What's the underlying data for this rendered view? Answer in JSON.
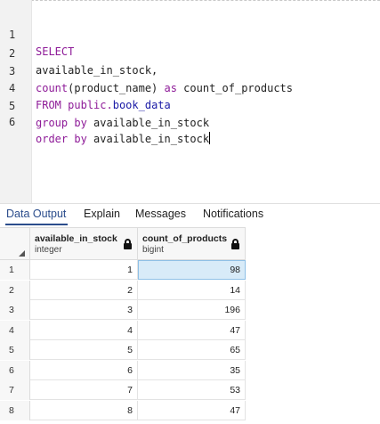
{
  "editor": {
    "lines": [
      {
        "n": "1"
      },
      {
        "n": "2"
      },
      {
        "n": "3"
      },
      {
        "n": "4"
      },
      {
        "n": "5"
      },
      {
        "n": "6"
      }
    ],
    "tokens": {
      "select": "SELECT",
      "line2": "available_in_stock,",
      "count_fn": "count",
      "count_args": "(product_name) ",
      "as_kw": "as",
      "alias": " count_of_products",
      "from_kw": "FROM",
      "schema": "public.",
      "table": "book_data",
      "group_kw": "group by",
      "group_col": " available_in_stock",
      "order_kw": "order by",
      "order_col": " available_in_stock"
    }
  },
  "tabs": [
    {
      "label": "Data Output",
      "active": true
    },
    {
      "label": "Explain",
      "active": false
    },
    {
      "label": "Messages",
      "active": false
    },
    {
      "label": "Notifications",
      "active": false
    }
  ],
  "grid": {
    "columns": [
      {
        "name": "available_in_stock",
        "type": "integer"
      },
      {
        "name": "count_of_products",
        "type": "bigint"
      }
    ],
    "rows": [
      {
        "num": "1",
        "a": "1",
        "b": "98"
      },
      {
        "num": "2",
        "a": "2",
        "b": "14"
      },
      {
        "num": "3",
        "a": "3",
        "b": "196"
      },
      {
        "num": "4",
        "a": "4",
        "b": "47"
      },
      {
        "num": "5",
        "a": "5",
        "b": "65"
      },
      {
        "num": "6",
        "a": "6",
        "b": "35"
      },
      {
        "num": "7",
        "a": "7",
        "b": "53"
      },
      {
        "num": "8",
        "a": "8",
        "b": "47"
      }
    ],
    "selected": {
      "row": 0,
      "col": "b"
    }
  }
}
